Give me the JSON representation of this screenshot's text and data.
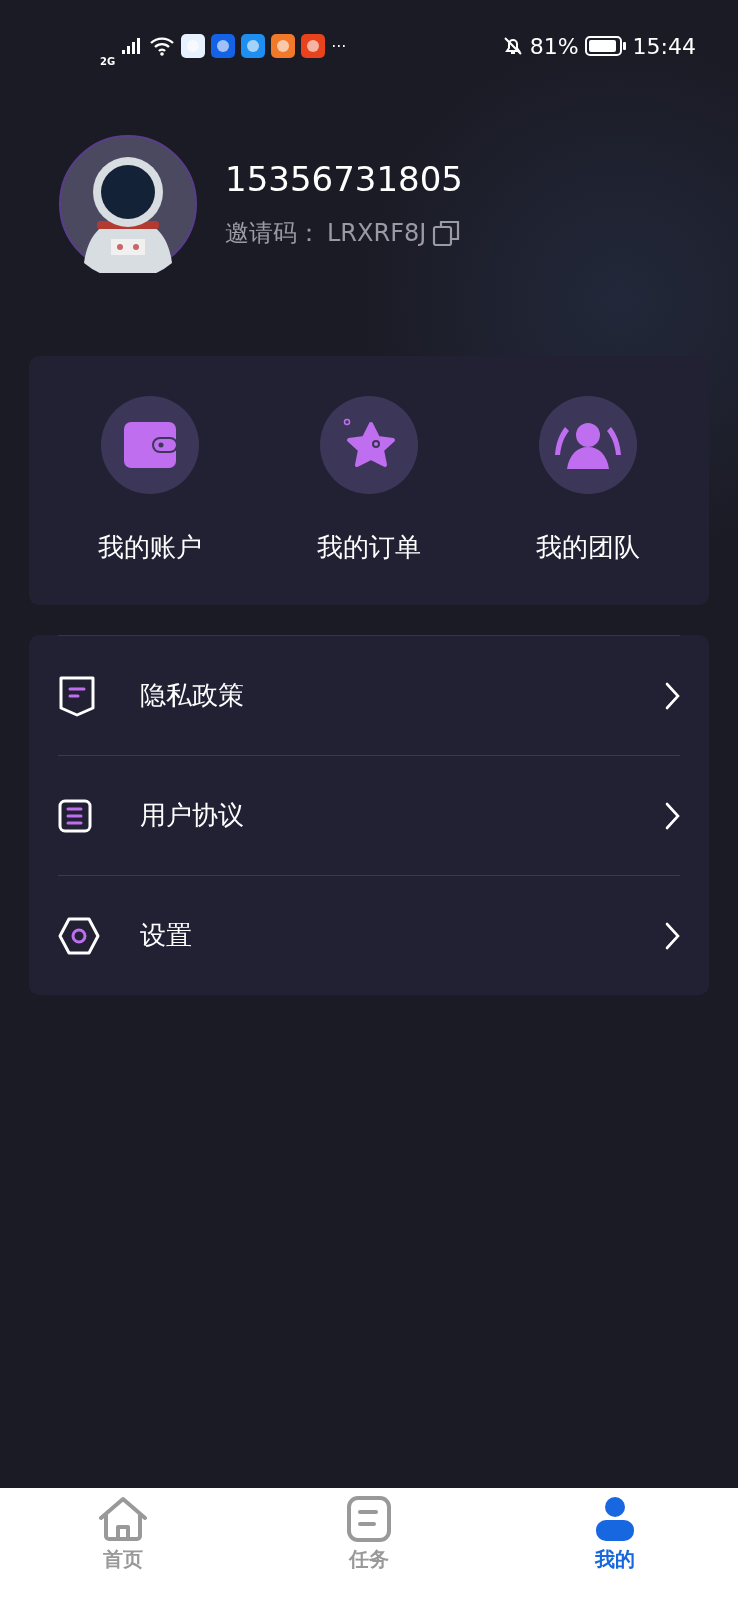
{
  "status_bar": {
    "network": "2G",
    "more": "···",
    "battery": "81%",
    "time": "15:44"
  },
  "profile": {
    "phone": "15356731805",
    "invite_label": "邀请码：",
    "invite_code": "LRXRF8J"
  },
  "shortcuts": [
    {
      "label": "我的账户",
      "kind": "wallet"
    },
    {
      "label": "我的订单",
      "kind": "star"
    },
    {
      "label": "我的团队",
      "kind": "team"
    }
  ],
  "menu": [
    {
      "label": "隐私政策",
      "kind": "policy"
    },
    {
      "label": "用户协议",
      "kind": "agreement"
    },
    {
      "label": "设置",
      "kind": "settings"
    }
  ],
  "tabs": [
    {
      "label": "首页",
      "kind": "home",
      "selected": false
    },
    {
      "label": "任务",
      "kind": "task",
      "selected": false
    },
    {
      "label": "我的",
      "kind": "me",
      "selected": true
    }
  ]
}
